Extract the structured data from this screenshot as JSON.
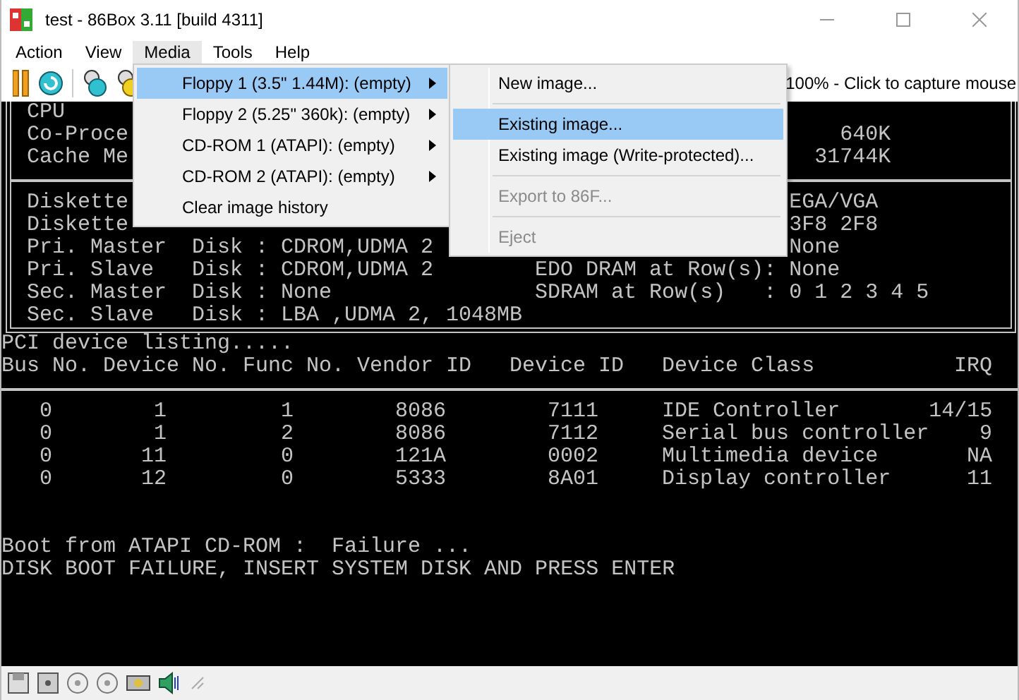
{
  "window": {
    "title": "test - 86Box 3.11 [build 4311]"
  },
  "menubar": [
    {
      "label": "Action",
      "selected": false
    },
    {
      "label": "View",
      "selected": false
    },
    {
      "label": "Media",
      "selected": true
    },
    {
      "label": "Tools",
      "selected": false
    },
    {
      "label": "Help",
      "selected": false
    }
  ],
  "toolbar": {
    "status_text": "100% - Click to capture mouse"
  },
  "media_menu": {
    "items": [
      {
        "label": "Floppy 1 (3.5\" 1.44M): (empty)",
        "has_submenu": true,
        "selected": true
      },
      {
        "label": "Floppy 2 (5.25\" 360k): (empty)",
        "has_submenu": true,
        "selected": false
      },
      {
        "label": "CD-ROM 1 (ATAPI): (empty)",
        "has_submenu": true,
        "selected": false
      },
      {
        "label": "CD-ROM 2 (ATAPI): (empty)",
        "has_submenu": true,
        "selected": false
      },
      {
        "label": "Clear image history",
        "has_submenu": false,
        "selected": false
      }
    ]
  },
  "floppy_submenu": {
    "items": [
      {
        "kind": "item",
        "label": "New image...",
        "disabled": false,
        "selected": false
      },
      {
        "kind": "separator"
      },
      {
        "kind": "item",
        "label": "Existing image...",
        "disabled": false,
        "selected": true
      },
      {
        "kind": "item",
        "label": "Existing image (Write-protected)...",
        "disabled": false,
        "selected": false
      },
      {
        "kind": "separator"
      },
      {
        "kind": "item",
        "label": "Export to 86F...",
        "disabled": true,
        "selected": false
      },
      {
        "kind": "separator"
      },
      {
        "kind": "item",
        "label": "Eject",
        "disabled": true,
        "selected": false
      }
    ]
  },
  "screen": {
    "bios_box": {
      "top_rows": [
        {
          "kind": "plain",
          "text": "CPU"
        },
        {
          "kind": "amount",
          "text": "Co-Proce",
          "value": "640K"
        },
        {
          "kind": "amount",
          "text": "Cache Me",
          "value": "31744K"
        }
      ],
      "bottom_rows": [
        {
          "kind": "setting",
          "text": "Diskette",
          "value": "EGA/VGA"
        },
        {
          "kind": "setting",
          "text": "Diskette",
          "value": "3F8 2F8"
        },
        {
          "kind": "setting",
          "text": "Pri. Master  Disk : CDROM,UDMA 2",
          "value": "None"
        },
        {
          "kind": "field",
          "text": "Pri. Slave   Disk : CDROM,UDMA 2",
          "value": "EDO DRAM at Row(s): None"
        },
        {
          "kind": "field",
          "text": "Sec. Master  Disk : None",
          "value": "SDRAM at Row(s)   : 0 1 2 3 4 5"
        },
        {
          "kind": "plain",
          "text": "Sec. Slave   Disk : LBA ,UDMA 2, 1048MB"
        }
      ]
    },
    "pci": {
      "title": "PCI device listing.....",
      "columns": [
        "Bus No.",
        "Device No.",
        "Func No.",
        "Vendor ID",
        "Device ID",
        "Device Class",
        "IRQ"
      ],
      "rows": [
        [
          "0",
          "1",
          "1",
          "8086",
          "7111",
          "IDE Controller",
          "14/15"
        ],
        [
          "0",
          "1",
          "2",
          "8086",
          "7112",
          "Serial bus controller",
          "9"
        ],
        [
          "0",
          "11",
          "0",
          "121A",
          "0002",
          "Multimedia device",
          "NA"
        ],
        [
          "0",
          "12",
          "0",
          "5333",
          "8A01",
          "Display controller",
          "11"
        ]
      ]
    },
    "messages": [
      "Boot from ATAPI CD-ROM :  Failure ...",
      "DISK BOOT FAILURE, INSERT SYSTEM DISK AND PRESS ENTER"
    ]
  }
}
